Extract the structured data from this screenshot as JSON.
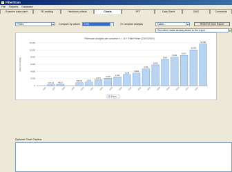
{
  "window": {
    "title": "FiberScan"
  },
  "menu": [
    "File",
    "Reports",
    "Database"
  ],
  "tabs": [
    {
      "label": "Examine data sheet"
    },
    {
      "label": "FE-reading"
    },
    {
      "label": "Hardness criteria"
    },
    {
      "label": "Charts",
      "active": true
    },
    {
      "label": "PFT"
    },
    {
      "label": "Data Sheet"
    },
    {
      "label": "GMO"
    },
    {
      "label": "Comments"
    }
  ],
  "controls": {
    "chart_type_value": "Prices",
    "compare_values_label": "Compare by values",
    "compare_values_value": "1994",
    "compare_analysis_label": "Or compare analysis",
    "compare_analysis_value": "Kaizer...",
    "remove_button": "REMOVE from Report",
    "find_charts_value": "Find other charts already added to the report"
  },
  "chart_data": {
    "type": "bar",
    "title": "Fiberscan Analysis per customer n = 10 + FiberPrimer (21/01/2010)",
    "ylabel": "Fiber (mm2/kg)",
    "yticks": [
      "12,000",
      "10,000",
      "8,000",
      "6,000",
      "4,000",
      "2,000",
      "0"
    ],
    "ylim": [
      0,
      12000
    ],
    "categories": [
      "1996",
      "1997",
      "1998",
      "1999",
      "2000",
      "2001",
      "2002",
      "2003",
      "2004",
      "2005",
      "2006",
      "2007",
      "2008",
      "2009",
      "2010",
      "2011",
      "2012"
    ],
    "series": [
      {
        "values": [
          0,
          274.34,
          400,
          0,
          826.02,
          1014,
          1671,
          2079,
          2454,
          3138,
          3534,
          4711,
          5810,
          7367,
          8006,
          8471,
          10032,
          11720
        ]
      }
    ],
    "data_labels": [
      "",
      "274.34",
      "400.3",
      "",
      "826.02",
      "1,014",
      "1,671",
      "2,079",
      "2,454",
      "3,138",
      "3,534",
      "4,711",
      "5,810",
      "7,367",
      "8,006",
      "8,471",
      "10,032",
      "11,720"
    ],
    "bar_color": "#b8d4f0",
    "bar_highlight": "#5a8fd0",
    "legend_label": "Prices"
  },
  "caption": {
    "label": "Optional Chart Caption"
  }
}
